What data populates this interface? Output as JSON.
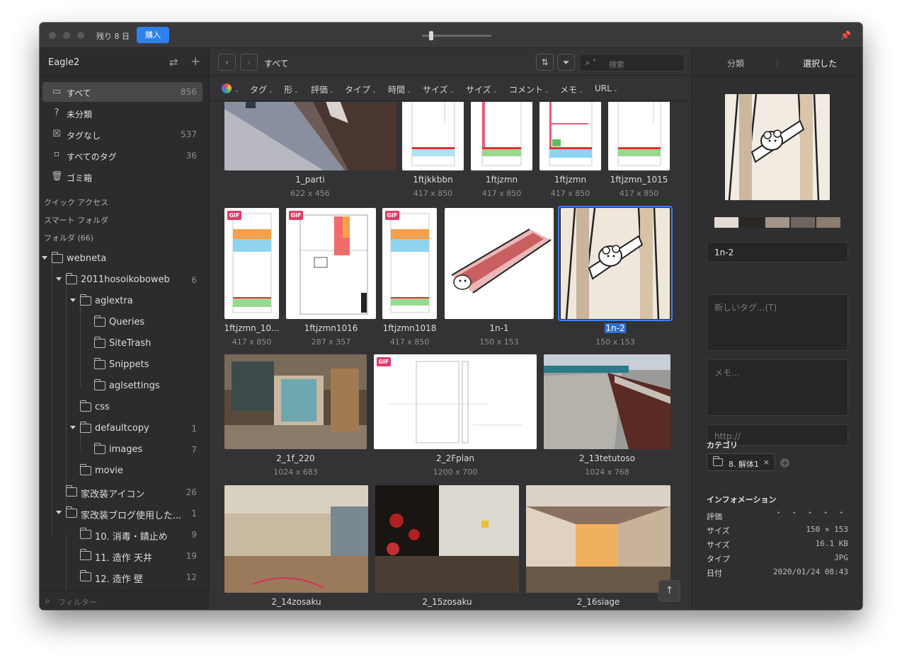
{
  "titlebar": {
    "trial_text": "残り 8 日",
    "buy_label": "購入"
  },
  "sidebar": {
    "library_name": "Eagle2",
    "items": [
      {
        "label": "すべて",
        "count": "856",
        "icon": "inbox-icon"
      },
      {
        "label": "未分類",
        "count": "",
        "icon": "question-icon"
      },
      {
        "label": "タグなし",
        "count": "537",
        "icon": "untagged-icon"
      },
      {
        "label": "すべてのタグ",
        "count": "36",
        "icon": "tag-icon"
      },
      {
        "label": "ゴミ箱",
        "count": "",
        "icon": "trash-icon"
      }
    ],
    "sections": {
      "quick": "クイック アクセス",
      "smart": "スマート フォルダ",
      "folders": "フォルダ (66)"
    },
    "tree": [
      {
        "label": "webneta",
        "count": ""
      },
      {
        "label": "2011hosoikoboweb",
        "count": "6"
      },
      {
        "label": "aglextra",
        "count": ""
      },
      {
        "label": "Queries",
        "count": ""
      },
      {
        "label": "SiteTrash",
        "count": ""
      },
      {
        "label": "Snippets",
        "count": ""
      },
      {
        "label": "aglsettings",
        "count": ""
      },
      {
        "label": "css",
        "count": ""
      },
      {
        "label": "defaultcopy",
        "count": "1"
      },
      {
        "label": "images",
        "count": "7"
      },
      {
        "label": "movie",
        "count": ""
      },
      {
        "label": "家改装アイコン",
        "count": "26"
      },
      {
        "label": "家改装ブログ使用した...",
        "count": "1"
      },
      {
        "label": "10. 消毒・錆止め",
        "count": "9"
      },
      {
        "label": "11. 造作 天井",
        "count": "19"
      },
      {
        "label": "12. 造作 壁",
        "count": "12"
      }
    ],
    "filter_placeholder": "フィルター"
  },
  "toolbar": {
    "breadcrumb": "すべて",
    "search_placeholder": "検索"
  },
  "filters": [
    "タグ",
    "形",
    "評価",
    "タイプ",
    "時間",
    "サイズ",
    "サイズ",
    "コメント",
    "メモ",
    "URL"
  ],
  "grid": [
    {
      "name": "1_parti",
      "size": "622 x 456"
    },
    {
      "name": "1ftjkkbbn",
      "size": "417 x 850"
    },
    {
      "name": "1ftjzmn",
      "size": "417 x 850"
    },
    {
      "name": "1ftjzmn",
      "size": "417 x 850"
    },
    {
      "name": "1ftjzmn_1015",
      "size": "417 x 850"
    },
    {
      "name": "1ftjzmn_10...",
      "size": "417 x 850",
      "gif": "GIF"
    },
    {
      "name": "1ftjzmn1016",
      "size": "287 x 357",
      "gif": "GIF"
    },
    {
      "name": "1ftjzmn1018",
      "size": "417 x 850",
      "gif": "GIF"
    },
    {
      "name": "1n-1",
      "size": "150 x 153"
    },
    {
      "name": "1n-2",
      "size": "150 x 153"
    },
    {
      "name": "2_1f_220",
      "size": "1024 x 683"
    },
    {
      "name": "2_2Fplan",
      "size": "1200 x 700",
      "gif": "GIF"
    },
    {
      "name": "2_13tetutoso",
      "size": "1024 x 768"
    },
    {
      "name": "2_14zosaku",
      "size": ""
    },
    {
      "name": "2_15zosaku",
      "size": ""
    },
    {
      "name": "2_16siage",
      "size": ""
    }
  ],
  "inspector": {
    "tabs": [
      "分類",
      "選択した"
    ],
    "palette": [
      "#e3dcd3",
      "#2a2826",
      "#a39587",
      "#6e655e",
      "#8b7d6f"
    ],
    "name": "1n-2",
    "tags_placeholder": "新しいタグ...(T)",
    "memo_placeholder": "メモ...",
    "url_placeholder": "http://",
    "category_heading": "カテゴリ",
    "category_chip": "8. 解体1",
    "info_heading": "インフォメーション",
    "info": [
      {
        "key": "評価",
        "value": "• • • • •"
      },
      {
        "key": "サイズ",
        "value": "150 × 153"
      },
      {
        "key": "サイズ",
        "value": "16.1 KB"
      },
      {
        "key": "タイプ",
        "value": "JPG"
      },
      {
        "key": "日付",
        "value": "2020/01/24 08:43"
      }
    ]
  }
}
